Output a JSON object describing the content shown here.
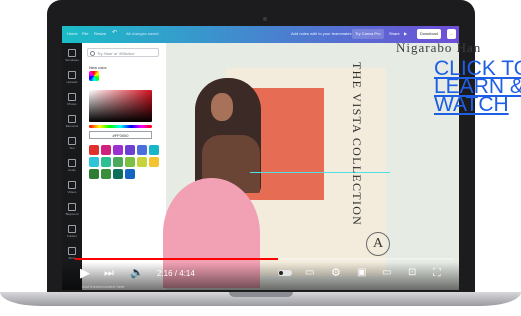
{
  "topbar": {
    "home": "Home",
    "file": "File",
    "resize": "Resize",
    "undo": "↶",
    "saved": "All changes saved",
    "add_notes": "Add notes with to your teammates",
    "try_pro": "Try Canva Pro",
    "share": "Share",
    "publish": "▶  ",
    "download": "Download",
    "more": "..."
  },
  "rail": {
    "items": [
      "Templates",
      "Uploads",
      "Photos",
      "Elements",
      "Text",
      "Audio",
      "Videos",
      "Bkground",
      "Folders",
      "More"
    ]
  },
  "color_panel": {
    "search_placeholder": "Try 'blue' or '#00c4cc'",
    "new_color_label": "New color",
    "hex_value": "#FF0000",
    "swatches": [
      "#e0312f",
      "#d1207e",
      "#9c2fcf",
      "#6b3fd1",
      "#4a6edb",
      "#17b6c9",
      "#2ec5d8",
      "#2bbf91",
      "#4ca85a",
      "#7bc045",
      "#c7d33a",
      "#f4c430",
      "#2e7d32",
      "#388e3c",
      "#0d6e5a",
      "#1565c0"
    ]
  },
  "design": {
    "title": "THE VISTA COLLECTION",
    "monogram": "A",
    "photo_color": "#e76c54",
    "shape_color": "#f2a1b4",
    "background_color": "#f3ecdc"
  },
  "overlay": {
    "watermark": "Nigarabo Han",
    "cta_line1": "CLICK TO",
    "cta_line2": "LEARN &",
    "cta_line3": "WATCH"
  },
  "player": {
    "current_time": "2:16",
    "duration": "4:14",
    "time_display": "2:16 / 4:14",
    "progress": 0.5354,
    "caption": "Add theme/context here",
    "accent": "#ff0000"
  }
}
